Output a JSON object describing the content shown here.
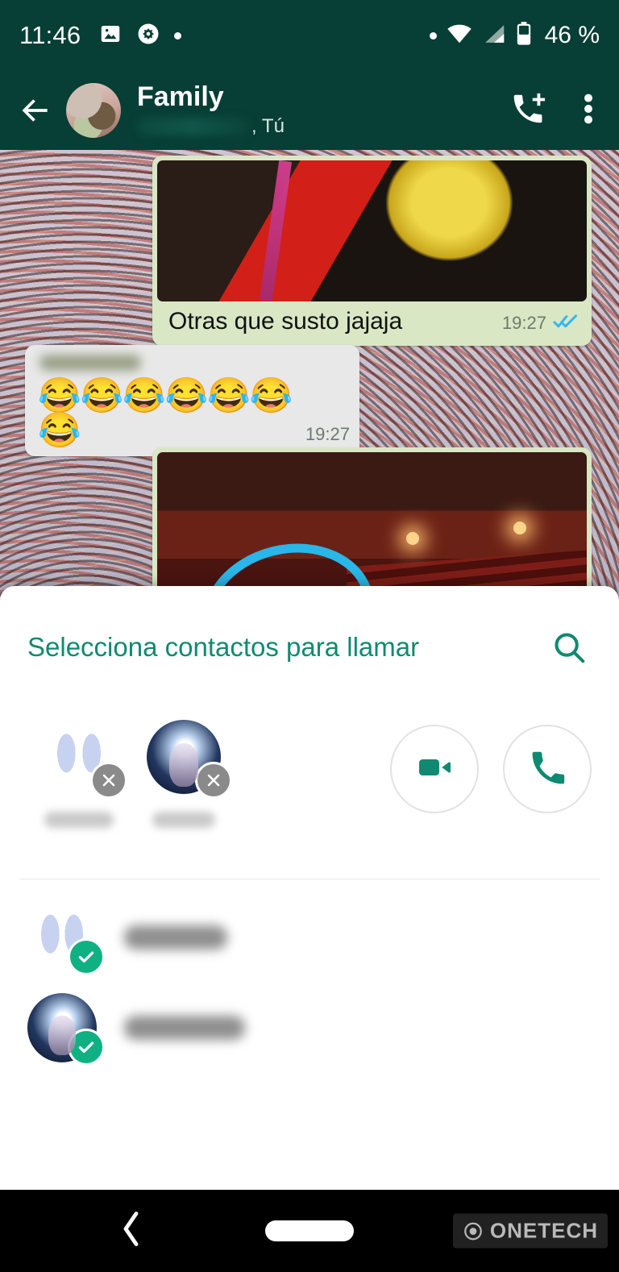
{
  "status_bar": {
    "time": "11:46",
    "battery_text": "46 %",
    "left_icons": [
      "image-icon",
      "settings-flower-icon",
      "dot-icon"
    ],
    "right_icons": [
      "dot-icon",
      "wifi-icon",
      "cellular-signal-icon",
      "battery-icon"
    ],
    "background_color": "#073E35"
  },
  "app_bar": {
    "back_icon": "back-arrow-icon",
    "avatar": "group-avatar",
    "title": "Family",
    "subtitle_tail": ", Tú",
    "subtitle_redacted": true,
    "actions": [
      {
        "name": "add-call-icon",
        "label": "Añadir llamada"
      },
      {
        "name": "overflow-menu-icon",
        "label": "Más opciones"
      }
    ]
  },
  "chat": {
    "messages": [
      {
        "direction": "outgoing",
        "has_image": true,
        "text": "Otras que susto jajaja",
        "time": "19:27",
        "status": "read",
        "ticks": "✓✓"
      },
      {
        "direction": "incoming",
        "sender_redacted": true,
        "text": "😂😂😂😂😂😂😂",
        "time": "19:27"
      },
      {
        "direction": "outgoing",
        "has_image": true,
        "image_description": "theater-photo-with-doodle",
        "text": "",
        "time": ""
      }
    ]
  },
  "sheet": {
    "title": "Selecciona contactos para llamar",
    "search_icon": "search-icon",
    "title_color": "#0f8a71",
    "selected_chips": [
      {
        "avatar": "slippers-avatar",
        "name_redacted": true,
        "remove_icon": "close-icon"
      },
      {
        "avatar": "girl-avatar",
        "name_redacted": true,
        "remove_icon": "close-icon"
      }
    ],
    "call_actions": [
      {
        "name": "video-call-button",
        "icon": "video-camera-icon",
        "color": "#0f8a71"
      },
      {
        "name": "voice-call-button",
        "icon": "phone-icon",
        "color": "#0f8a71"
      }
    ],
    "contacts": [
      {
        "avatar": "slippers-avatar",
        "name_redacted": true,
        "selected": true,
        "check_icon": "check-icon"
      },
      {
        "avatar": "girl-avatar",
        "name_redacted": true,
        "selected": true,
        "check_icon": "check-icon"
      }
    ],
    "check_color": "#0fb183"
  },
  "nav_bar": {
    "back_icon": "nav-back-icon",
    "home_pill": "home-indicator",
    "watermark": "ONETECH"
  }
}
